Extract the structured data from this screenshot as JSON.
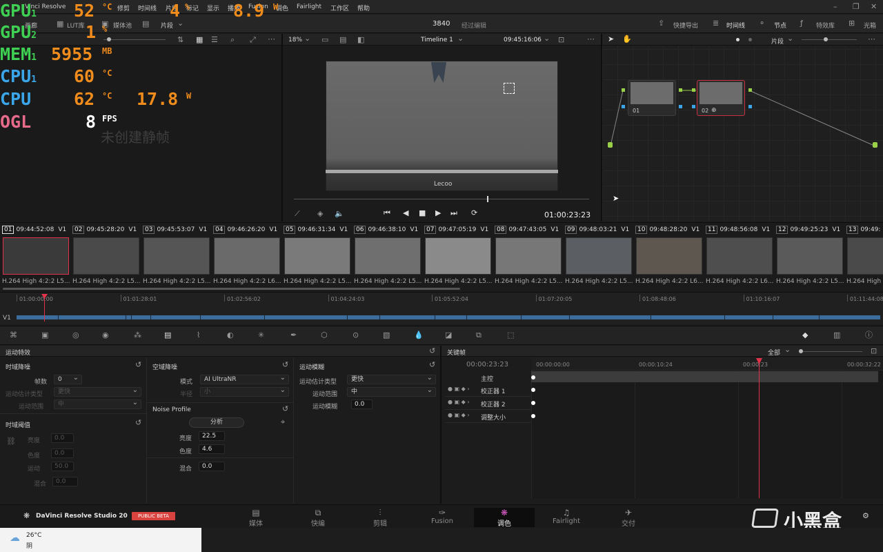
{
  "menubar": {
    "app_title": "Vinci Resolve",
    "items": [
      "修剪",
      "时间线",
      "片段",
      "标记",
      "显示",
      "播放",
      "Fusion",
      "调色",
      "Fairlight",
      "工作区",
      "帮助"
    ]
  },
  "hud": {
    "gpu1": {
      "label": "GPU",
      "sub": "1",
      "value": "52",
      "unit": "°C",
      "value2": "4",
      "unit2": "%",
      "value3": "8.9",
      "unit3": "W"
    },
    "gpu2": {
      "label": "GPU",
      "sub": "2",
      "value": "1",
      "unit": "%"
    },
    "mem": {
      "label": "MEM",
      "sub": "1",
      "value": "5955",
      "unit": "MB"
    },
    "cpu1": {
      "label": "CPU",
      "sub": "1",
      "value": "60",
      "unit": "°C"
    },
    "cpu": {
      "label": "CPU",
      "value": "62",
      "unit": "°C",
      "value2": "17.8",
      "unit2": "W"
    },
    "ogl": {
      "label": "OGL",
      "value": "8",
      "unit": "FPS"
    }
  },
  "toolbar": {
    "gallery_label": "画廊",
    "lut_label": "LUT库",
    "media_pool_label": "媒体池",
    "clips_label": "片段",
    "resolution": "3840",
    "edited_label": "经过编辑",
    "quick_export": "快捷导出",
    "timeline": "时间线",
    "nodes": "节点",
    "effects": "特效库",
    "lightbox": "光箱"
  },
  "viewer": {
    "zoom": "18%",
    "timeline_name": "Timeline 1",
    "timecode": "09:45:16:06",
    "playhead_tc": "01:00:23:23",
    "no_still": "未创建静帧",
    "device_logo": "Lecoo"
  },
  "node_editor": {
    "mode_label": "片段",
    "nodes": [
      {
        "id": "01"
      },
      {
        "id": "02"
      }
    ]
  },
  "clips": [
    {
      "num": "01",
      "tc": "09:44:52:08",
      "track": "V1",
      "codec": "H.264 High 4:2:2 L5..."
    },
    {
      "num": "02",
      "tc": "09:45:28:20",
      "track": "V1",
      "codec": "H.264 High 4:2:2 L5..."
    },
    {
      "num": "03",
      "tc": "09:45:53:07",
      "track": "V1",
      "codec": "H.264 High 4:2:2 L5..."
    },
    {
      "num": "04",
      "tc": "09:46:26:20",
      "track": "V1",
      "codec": "H.264 High 4:2:2 L6..."
    },
    {
      "num": "05",
      "tc": "09:46:31:34",
      "track": "V1",
      "codec": "H.264 High 4:2:2 L5..."
    },
    {
      "num": "06",
      "tc": "09:46:38:10",
      "track": "V1",
      "codec": "H.264 High 4:2:2 L5..."
    },
    {
      "num": "07",
      "tc": "09:47:05:19",
      "track": "V1",
      "codec": "H.264 High 4:2:2 L5..."
    },
    {
      "num": "08",
      "tc": "09:47:43:05",
      "track": "V1",
      "codec": "H.264 High 4:2:2 L5..."
    },
    {
      "num": "09",
      "tc": "09:48:03:21",
      "track": "V1",
      "codec": "H.264 High 4:2:2 L5..."
    },
    {
      "num": "10",
      "tc": "09:48:28:20",
      "track": "V1",
      "codec": "H.264 High 4:2:2 L6..."
    },
    {
      "num": "11",
      "tc": "09:48:56:08",
      "track": "V1",
      "codec": "H.264 High 4:2:2 L6..."
    },
    {
      "num": "12",
      "tc": "09:49:25:23",
      "track": "V1",
      "codec": "H.264 High 4:2:2 L5..."
    },
    {
      "num": "13",
      "tc": "09:49:",
      "track": "",
      "codec": "H.264 High"
    }
  ],
  "mini_timeline": {
    "ruler": [
      "01:00:00:00",
      "01:01:28:01",
      "01:02:56:02",
      "01:04:24:03",
      "01:05:52:04",
      "01:07:20:05",
      "01:08:48:06",
      "01:10:16:07",
      "01:11:44:08"
    ],
    "track": "V1"
  },
  "motion_fx": {
    "title": "运动特效",
    "temporal_nr": {
      "title": "时域降噪",
      "frames_label": "帧数",
      "frames_value": "0",
      "motion_est_label": "运动估计类型",
      "motion_est_value": "更快",
      "motion_range_label": "运动范围",
      "motion_range_value": "中"
    },
    "temporal_threshold": {
      "title": "时域阈值",
      "luma_label": "亮度",
      "luma_value": "0.0",
      "chroma_label": "色度",
      "chroma_value": "0.0",
      "motion_label": "运动",
      "motion_value": "50.0",
      "blend_label": "混合",
      "blend_value": "0.0"
    },
    "spatial_nr": {
      "title": "空域降噪",
      "mode_label": "模式",
      "mode_value": "AI UltraNR",
      "radius_label": "半径",
      "radius_value": "小",
      "noise_profile": "Noise Profile",
      "analyze": "分析",
      "luma_label": "亮度",
      "luma_value": "22.5",
      "chroma_label": "色度",
      "chroma_value": "4.6",
      "blend_label": "混合",
      "blend_value": "0.0"
    },
    "motion_blur": {
      "title": "运动模糊",
      "est_label": "运动估计类型",
      "est_value": "更快",
      "range_label": "运动范围",
      "range_value": "中",
      "blur_label": "运动模糊",
      "blur_value": "0.0"
    }
  },
  "keyframes": {
    "title": "关键帧",
    "filter": "全部",
    "current_tc": "00:00:23:23",
    "ruler": [
      "00:00:00:00",
      "00:00:10:24",
      "00:00:23",
      "00:00:32:22"
    ],
    "rows": [
      "主控",
      "校正器 1",
      "校正器 2",
      "调整大小"
    ]
  },
  "pages": {
    "brand": "DaVinci Resolve Studio 20",
    "beta": "PUBLIC BETA",
    "tabs": [
      "媒体",
      "快编",
      "剪辑",
      "Fusion",
      "调色",
      "Fairlight",
      "交付"
    ],
    "active": "调色"
  },
  "taskbar": {
    "temp": "26°C",
    "weather": "阴"
  },
  "watermark": "小黑盒",
  "colors": {
    "accent": "#e0334b",
    "hud_green": "#3fcf52",
    "hud_orange": "#f08c1c",
    "hud_blue": "#3aa5e8",
    "hud_pink": "#e66a8a"
  }
}
